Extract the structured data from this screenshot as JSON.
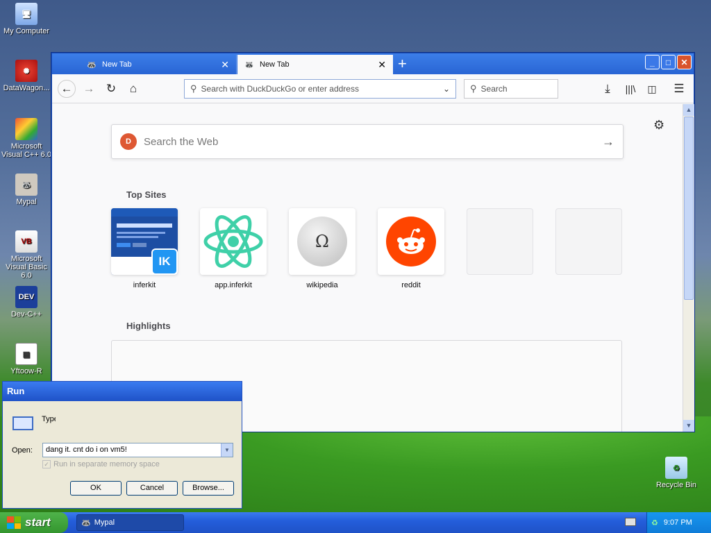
{
  "desktop": {
    "icons": [
      {
        "label": "My Computer"
      },
      {
        "label": "DataWagon..."
      },
      {
        "label": "Microsoft Visual C++ 6.0"
      },
      {
        "label": "Mypal"
      },
      {
        "label": "Microsoft Visual Basic 6.0"
      },
      {
        "label": "Dev-C++"
      },
      {
        "label": "Yftoow-R"
      },
      {
        "label": "Recycle Bin"
      }
    ]
  },
  "browser": {
    "tabs": [
      {
        "label": "New Tab",
        "active": false
      },
      {
        "label": "New Tab",
        "active": true
      }
    ],
    "address_placeholder": "Search with DuckDuckGo or enter address",
    "search_placeholder": "Search",
    "websearch_placeholder": "Search the Web",
    "top_sites_title": "Top Sites",
    "highlights_title": "Highlights",
    "top_sites": [
      {
        "name": "inferkit",
        "badge": "IK"
      },
      {
        "name": "app.inferkit"
      },
      {
        "name": "wikipedia",
        "glyph": "Ω"
      },
      {
        "name": "reddit"
      },
      {
        "name": ""
      },
      {
        "name": ""
      }
    ]
  },
  "run_dialog": {
    "title": "Run",
    "description": "Type the name of a program, folder, document, or Internet resource",
    "open_label": "Open:",
    "open_value": "dang it. cnt do i on vm5!",
    "checkbox_label": "Run in separate memory space",
    "ok": "OK",
    "cancel": "Cancel",
    "browse": "Browse..."
  },
  "taskbar": {
    "start": "start",
    "task": "Mypal",
    "clock": "9:07 PM"
  },
  "colors": {
    "xp_blue": "#245edb",
    "start_green": "#34962f",
    "reddit": "#ff4500",
    "react": "#3fd0a8",
    "duckduckgo": "#de5833"
  }
}
